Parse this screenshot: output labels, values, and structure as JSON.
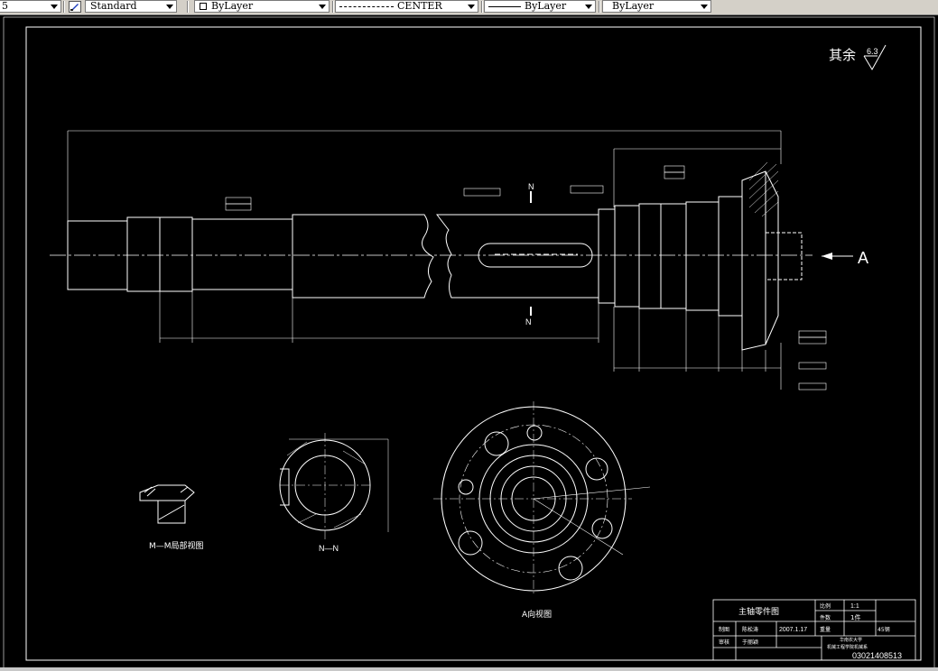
{
  "toolbar": {
    "first_combo": "5",
    "text_style": "Standard",
    "layer": "ByLayer",
    "linetype": "CENTER",
    "lineweight": "ByLayer",
    "plotstyle": "ByLayer"
  },
  "drawing": {
    "surface_roughness_label": "其余",
    "surface_roughness_value": "6.3",
    "section_mark_n": "N",
    "view_arrow_label": "A",
    "section_mm_caption": "M—M局部视图",
    "section_nn_caption": "N—N",
    "view_a_caption": "A向视图"
  },
  "title_block": {
    "part_name": "主轴零件图",
    "scale_label": "比例",
    "scale_value": "1:1",
    "qty_label": "件数",
    "qty_value": "1件",
    "draw_label": "制图",
    "drawer": "陈松涛",
    "date": "2007.1.17",
    "weight_label": "重量",
    "material": "45钢",
    "check_label": "审核",
    "checker": "于丽颖",
    "school": "华南农大学",
    "dept": "机械工程学院机械系",
    "drawing_no": "03021408513"
  }
}
